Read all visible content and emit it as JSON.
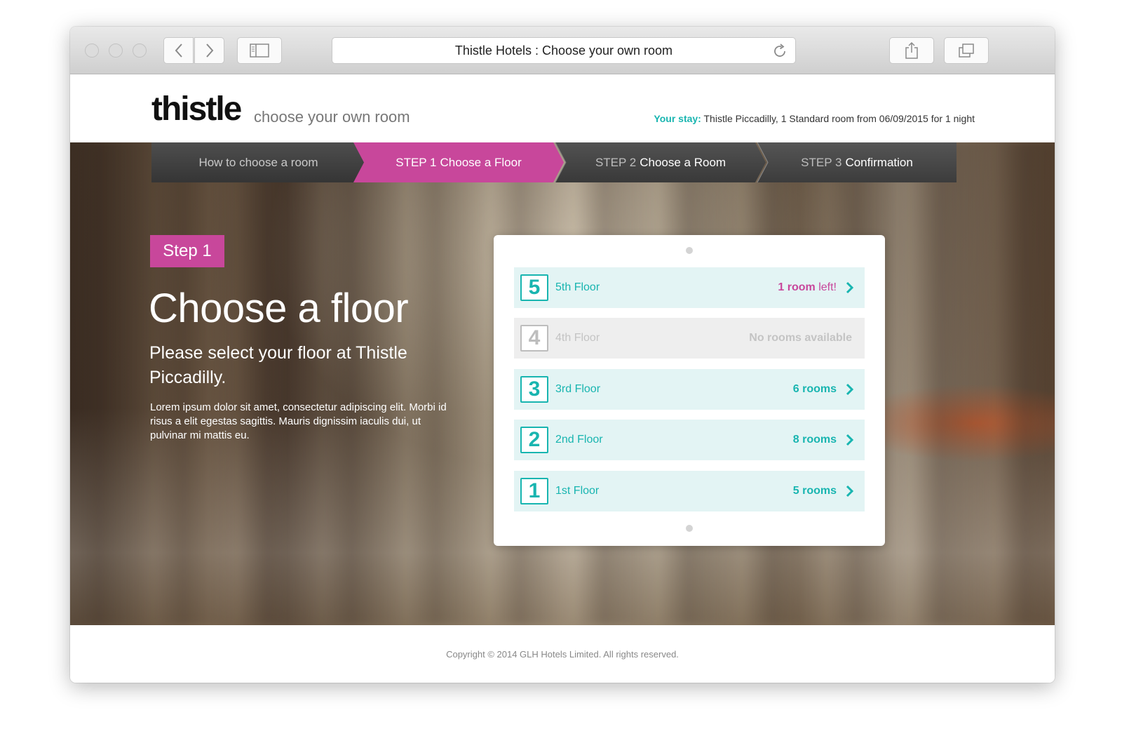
{
  "browser": {
    "window_title": "Thistle Hotels : Choose your own room"
  },
  "header": {
    "logo": "thistle",
    "tagline": "choose your own room",
    "stay_label": "Your stay:",
    "stay_text": "Thistle Piccadilly, 1 Standard room from 06/09/2015 for 1 night"
  },
  "steps": [
    {
      "prefix": "",
      "label": "How to choose a room"
    },
    {
      "prefix": "STEP 1",
      "label": "Choose a Floor"
    },
    {
      "prefix": "STEP 2",
      "label": "Choose a Room"
    },
    {
      "prefix": "STEP 3",
      "label": "Confirmation"
    }
  ],
  "main": {
    "step_badge": "Step 1",
    "title": "Choose a floor",
    "subtitle": "Please select your floor at Thistle Piccadilly.",
    "body": "Lorem ipsum dolor sit amet, consectetur adipiscing elit. Morbi id risus a elit egestas sagittis. Mauris dignissim iaculis dui, ut pulvinar mi mattis eu."
  },
  "floors": [
    {
      "number": "5",
      "name": "5th Floor",
      "availability_strong": "1 room",
      "availability_light": " left!",
      "available": true
    },
    {
      "number": "4",
      "name": "4th Floor",
      "availability_strong": "No rooms available",
      "availability_light": "",
      "available": false
    },
    {
      "number": "3",
      "name": "3rd Floor",
      "availability_strong": "6 rooms",
      "availability_light": "",
      "available": true
    },
    {
      "number": "2",
      "name": "2nd Floor",
      "availability_strong": "8 rooms",
      "availability_light": "",
      "available": true
    },
    {
      "number": "1",
      "name": "1st Floor",
      "availability_strong": "5 rooms",
      "availability_light": "",
      "available": true
    }
  ],
  "footer": {
    "copyright": "Copyright © 2014 GLH Hotels Limited. All rights reserved."
  },
  "colors": {
    "accent_pink": "#c8479b",
    "accent_teal": "#18b5b0"
  }
}
